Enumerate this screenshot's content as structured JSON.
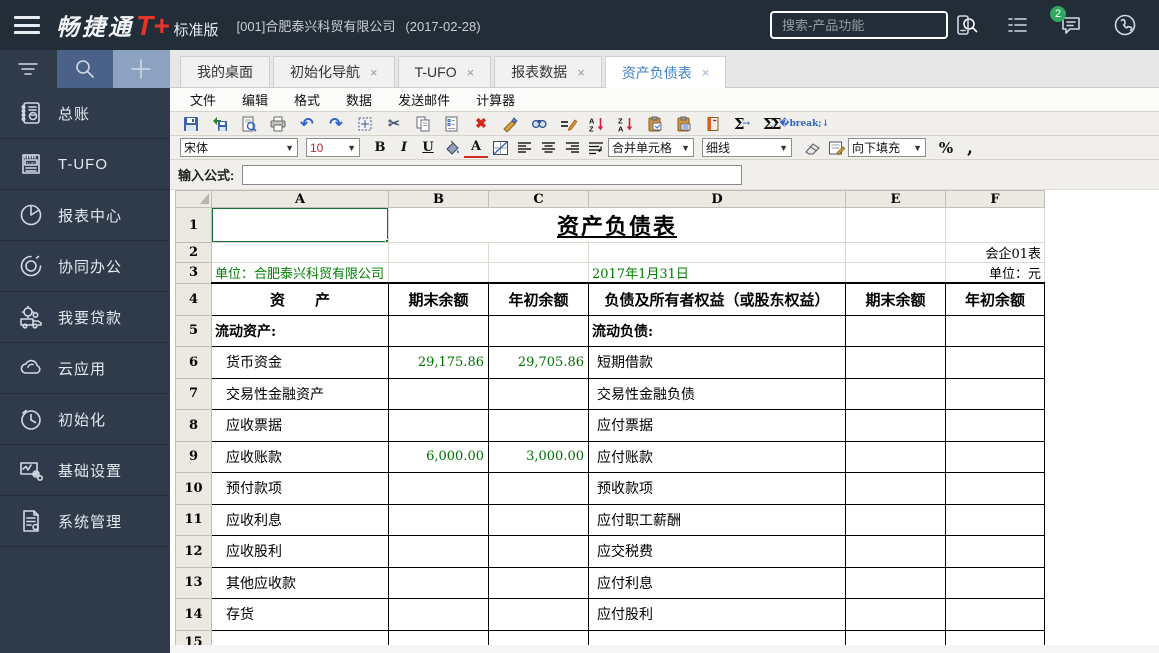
{
  "topbar": {
    "brand": "畅捷通",
    "brand_t": "T+",
    "edition": "标准版",
    "account": "[001]合肥泰兴科贸有限公司",
    "date": "(2017-02-28)",
    "search_placeholder": "搜索-产品功能",
    "chat_badge": "2",
    "icons": [
      "menu-icon",
      "search-icon",
      "mobile-icon",
      "tasklist-icon",
      "chat-icon",
      "service-phone-icon"
    ]
  },
  "sidebar": {
    "buttons": [
      {
        "icon": "filter-icon"
      },
      {
        "icon": "search-icon"
      },
      {
        "icon": "plus-icon"
      }
    ],
    "items": [
      {
        "label": "总账",
        "icon": "ledger-icon"
      },
      {
        "label": "T-UFO",
        "icon": "tufo-report-icon"
      },
      {
        "label": "报表中心",
        "icon": "pie-chart-icon"
      },
      {
        "label": "协同办公",
        "icon": "collaboration-icon"
      },
      {
        "label": "我要贷款",
        "icon": "loan-truck-icon"
      },
      {
        "label": "云应用",
        "icon": "cloud-icon"
      },
      {
        "label": "初始化",
        "icon": "clock-icon"
      },
      {
        "label": "基础设置",
        "icon": "settings-chart-icon"
      },
      {
        "label": "系统管理",
        "icon": "system-doc-icon"
      }
    ]
  },
  "tabs": [
    {
      "label": "我的桌面",
      "closable": false,
      "active": false
    },
    {
      "label": "初始化导航",
      "closable": true,
      "active": false
    },
    {
      "label": "T-UFO",
      "closable": true,
      "active": false
    },
    {
      "label": "报表数据",
      "closable": true,
      "active": false
    },
    {
      "label": "资产负债表",
      "closable": true,
      "active": true
    }
  ],
  "menubar": {
    "items": [
      "文件",
      "编辑",
      "格式",
      "数据",
      "发送邮件",
      "计算器"
    ]
  },
  "toolbar_icons": [
    "save",
    "save-all",
    "print-preview",
    "print",
    "undo",
    "redo",
    "select-area",
    "cut",
    "copy",
    "paste-special",
    "delete",
    "format-painter",
    "find",
    "edit-formula",
    "sort-ascending",
    "sort-descending",
    "paste-value",
    "paste-format",
    "report-book",
    "sum",
    "sum-column",
    "sum-row"
  ],
  "toolbar_format": {
    "font": "宋体",
    "size": "10",
    "bold": "B",
    "italic": "I",
    "underline": "U",
    "merge_cells": "合并单元格",
    "line_style": "细线",
    "fill_direction": "向下填充",
    "percent": "%",
    "comma": ","
  },
  "formula": {
    "label": "输入公式:",
    "value": ""
  },
  "sheet": {
    "col_headers": [
      "A",
      "B",
      "C",
      "D",
      "E",
      "F"
    ],
    "row_headers": [
      "1",
      "2",
      "3",
      "4",
      "5",
      "6",
      "7",
      "8",
      "9",
      "10",
      "11",
      "12",
      "13",
      "14",
      "15"
    ],
    "title": "资产负债表",
    "report_code": "会企01表",
    "unit_company": "单位：合肥泰兴科贸有限公司",
    "report_date": "2017年1月31日",
    "unit_label": "单位：元",
    "header": {
      "asset": "资　　产",
      "end_balance": "期末余额",
      "begin_balance": "年初余额",
      "liability": "负债及所有者权益（或股东权益）",
      "end_balance2": "期末余额",
      "begin_balance2": "年初余额"
    },
    "rows": [
      {
        "a": "流动资产:",
        "b": "",
        "c": "",
        "d": "流动负债:",
        "e": "",
        "f": ""
      },
      {
        "a": "货币资金",
        "b": "29,175.86",
        "c": "29,705.86",
        "d": "短期借款",
        "e": "",
        "f": ""
      },
      {
        "a": "交易性金融资产",
        "b": "",
        "c": "",
        "d": "交易性金融负债",
        "e": "",
        "f": ""
      },
      {
        "a": "应收票据",
        "b": "",
        "c": "",
        "d": "应付票据",
        "e": "",
        "f": ""
      },
      {
        "a": "应收账款",
        "b": "6,000.00",
        "c": "3,000.00",
        "d": "应付账款",
        "e": "",
        "f": ""
      },
      {
        "a": "预付款项",
        "b": "",
        "c": "",
        "d": "预收款项",
        "e": "",
        "f": ""
      },
      {
        "a": "应收利息",
        "b": "",
        "c": "",
        "d": "应付职工薪酬",
        "e": "",
        "f": ""
      },
      {
        "a": "应收股利",
        "b": "",
        "c": "",
        "d": "应交税费",
        "e": "",
        "f": ""
      },
      {
        "a": "其他应收款",
        "b": "",
        "c": "",
        "d": "应付利息",
        "e": "",
        "f": ""
      },
      {
        "a": "存货",
        "b": "",
        "c": "",
        "d": "应付股利",
        "e": "",
        "f": ""
      },
      {
        "a": "",
        "b": "",
        "c": "",
        "d": "",
        "e": "",
        "f": ""
      }
    ]
  }
}
